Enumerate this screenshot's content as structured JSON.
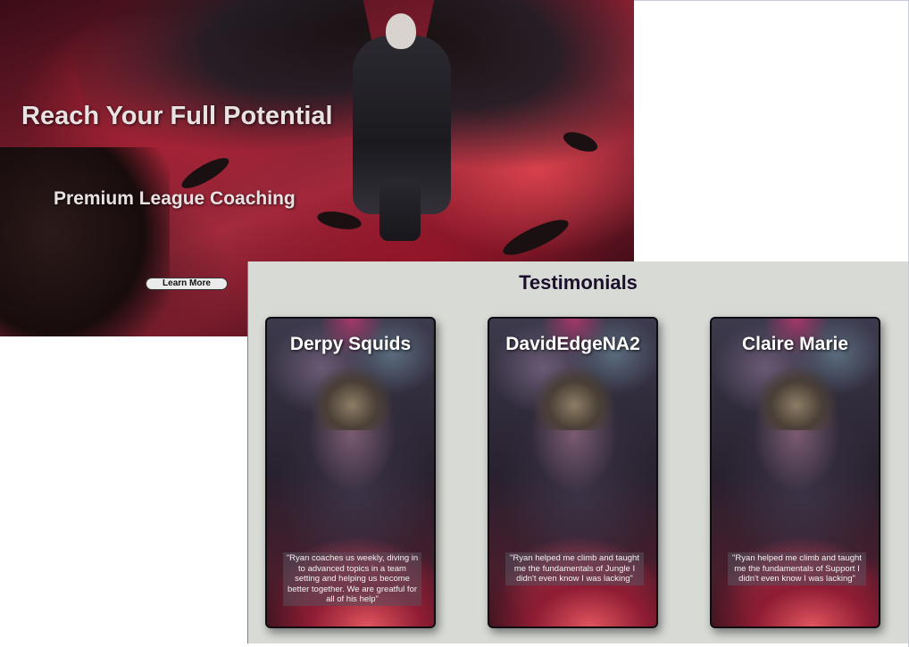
{
  "hero": {
    "title": "Reach Your Full Potential",
    "subtitle": "Premium League Coaching",
    "button_label": "Learn More"
  },
  "testimonials": {
    "heading": "Testimonials",
    "cards": [
      {
        "name": "Derpy Squids",
        "quote": "\"Ryan coaches us weekly, diving in to advanced topics in a team setting and helping us become better together. We are greatful for all of his help\""
      },
      {
        "name": "DavidEdgeNA2",
        "quote": "\"Ryan helped me climb and taught me the fundamentals of Jungle I didn't even know I was lacking\""
      },
      {
        "name": "Claire Marie",
        "quote": "\"Ryan helped me climb and taught me the fundamentals of Support I didn't even know I was lacking\""
      }
    ]
  },
  "colors": {
    "testimonials_background": "#d8dad6",
    "heading_color": "#1c0f2c",
    "hero_accent": "#a22a3c"
  }
}
